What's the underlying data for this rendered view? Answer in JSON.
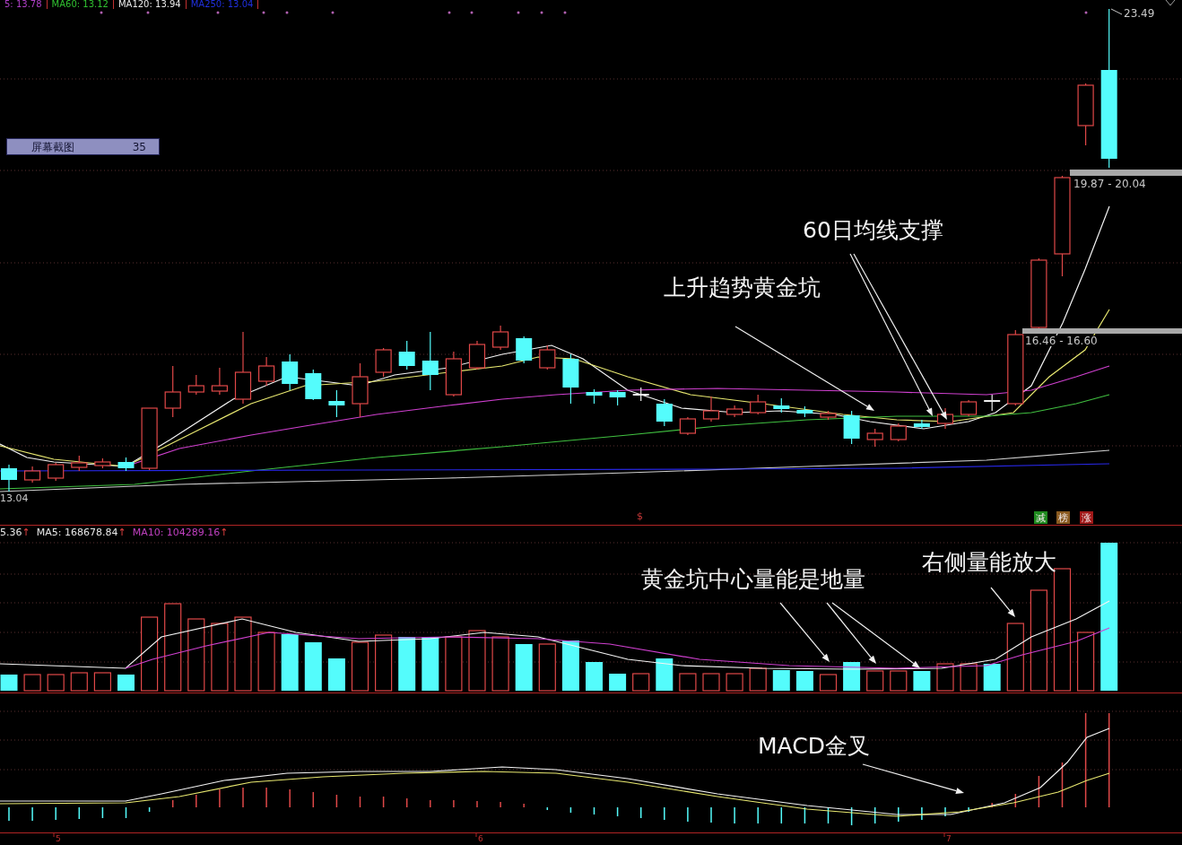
{
  "price_panel": {
    "ma_legend": [
      {
        "text": "5: 13.78",
        "color": "#b040c8"
      },
      {
        "text": "MA60: 13.12",
        "color": "#30c030"
      },
      {
        "text": "MA120: 13.94",
        "color": "#e8e8e8"
      },
      {
        "text": "MA250: 13.04",
        "color": "#2030e0"
      }
    ],
    "screenshot_tag": {
      "title": "屏幕截图",
      "count": "35"
    },
    "high_label": "23.49",
    "price_zones": [
      "19.87 - 20.04",
      "16.46 - 16.60"
    ],
    "low_label": "13.04",
    "annotations": [
      "60日均线支撑",
      "上升趋势黄金坑"
    ],
    "signals": [
      {
        "kind": "mark",
        "text": "$",
        "color": "#c83838"
      },
      {
        "kind": "badge",
        "text": "减",
        "color": "#1f8a1f"
      },
      {
        "kind": "badge",
        "text": "榜",
        "color": "#8a5a20"
      },
      {
        "kind": "badge",
        "text": "涨",
        "color": "#a01818"
      }
    ]
  },
  "volume_panel": {
    "legend": [
      {
        "text": "5.36",
        "arrow": "↑",
        "color": "#e8e8e8"
      },
      {
        "text": "MA5: 168678.84",
        "arrow": "↑",
        "color": "#e8e8e8"
      },
      {
        "text": "MA10: 104289.16",
        "arrow": "↑",
        "color": "#c040c0"
      }
    ],
    "annotations": [
      "黄金坑中心量能是地量",
      "右侧量能放大"
    ]
  },
  "macd_panel": {
    "annotations": [
      "MACD金叉"
    ]
  },
  "time_axis": {
    "labels": [
      "5",
      "6",
      "7"
    ]
  }
}
